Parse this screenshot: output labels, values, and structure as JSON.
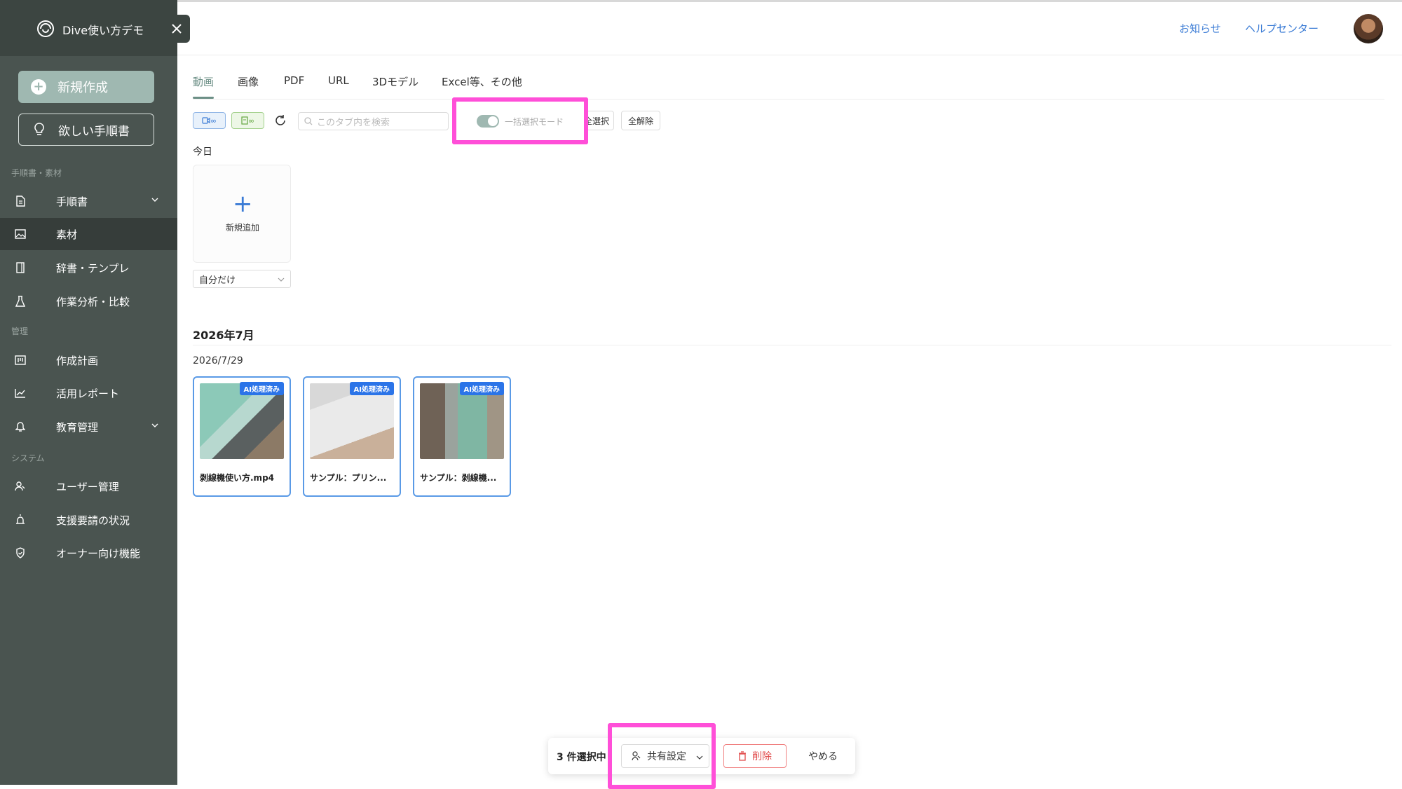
{
  "app": {
    "name": "Dive使い方デモ"
  },
  "sidebar": {
    "new_button": "新規作成",
    "want_button": "欲しい手順書",
    "sections": [
      "手順書・素材",
      "管理",
      "システム"
    ],
    "items": [
      {
        "label": "手順書",
        "icon": "document-icon",
        "expandable": true
      },
      {
        "label": "素材",
        "icon": "image-icon",
        "active": true
      },
      {
        "label": "辞書・テンプレ",
        "icon": "book-icon"
      },
      {
        "label": "作業分析・比較",
        "icon": "flask-icon"
      },
      {
        "label": "作成計画",
        "icon": "kanban-icon"
      },
      {
        "label": "活用レポート",
        "icon": "chart-icon"
      },
      {
        "label": "教育管理",
        "icon": "bell-icon",
        "expandable": true
      },
      {
        "label": "ユーザー管理",
        "icon": "users-icon"
      },
      {
        "label": "支援要請の状況",
        "icon": "alarm-icon"
      },
      {
        "label": "オーナー向け機能",
        "icon": "shield-icon"
      }
    ]
  },
  "header": {
    "links": [
      "お知らせ",
      "ヘルプセンター"
    ]
  },
  "tabs": [
    "動画",
    "画像",
    "PDF",
    "URL",
    "3Dモデル",
    "Excel等、その他"
  ],
  "toolbar": {
    "chip_video": "∞",
    "chip_doc": "∞",
    "search_placeholder": "このタブ内を検索",
    "bulk_mode_label": "一括選択モード",
    "select_all_label": "全選択",
    "clear_label": "全解除"
  },
  "today": {
    "label": "今日",
    "add_label": "新規追加",
    "filter_value": "自分だけ"
  },
  "archive": {
    "month": "2026年7月",
    "date": "2026/7/29",
    "badge": "AI処理済み",
    "items": [
      {
        "title": "剥線機使い方.mp4"
      },
      {
        "title": "サンプル：プリン..."
      },
      {
        "title": "サンプル：剥線機..."
      }
    ]
  },
  "action_bar": {
    "count_label": "3 件選択中",
    "share_label": "共有設定",
    "delete_label": "削除",
    "cancel_label": "やめる"
  },
  "colors": {
    "accent": "#6c8f86",
    "link": "#3a7bd5",
    "highlight": "#ff4fd8",
    "sidebar": "#4a5450"
  }
}
